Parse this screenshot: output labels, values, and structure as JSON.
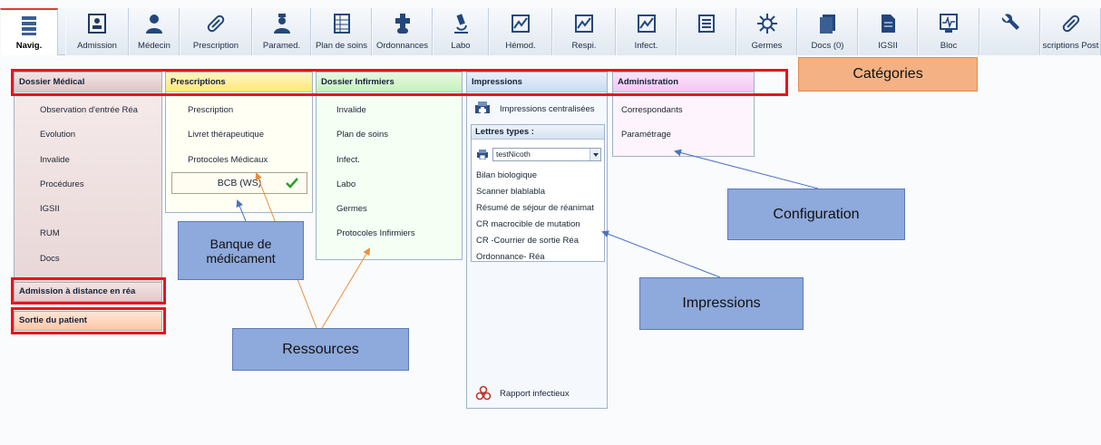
{
  "toolbar": {
    "tabs": [
      {
        "label": "Navig.",
        "icon": "grid-icon"
      },
      {
        "label": "Admission",
        "icon": "id-card-icon"
      },
      {
        "label": "Médecin",
        "icon": "doctor-icon"
      },
      {
        "label": "Prescription",
        "icon": "capsule-icon"
      },
      {
        "label": "Paramed.",
        "icon": "nurse-icon"
      },
      {
        "label": "Plan de soins",
        "icon": "care-plan-icon"
      },
      {
        "label": "Ordonnances",
        "icon": "cross-pill-icon"
      },
      {
        "label": "Labo",
        "icon": "microscope-icon"
      },
      {
        "label": "Hémod.",
        "icon": "chart-icon"
      },
      {
        "label": "Respi.",
        "icon": "chart-icon"
      },
      {
        "label": "Infect.",
        "icon": "chart-icon"
      },
      {
        "label": "",
        "icon": "list-icon"
      },
      {
        "label": "Germes",
        "icon": "germ-icon"
      },
      {
        "label": "Docs (0)",
        "icon": "documents-icon"
      },
      {
        "label": "IGSII",
        "icon": "file-icon"
      },
      {
        "label": "Bloc",
        "icon": "monitor-icon"
      },
      {
        "label": "",
        "icon": "wrench-icon"
      },
      {
        "label": "scriptions Post",
        "icon": "capsule-icon"
      }
    ]
  },
  "categories": {
    "dossier_medical": {
      "title": "Dossier Médical",
      "items": [
        "Observation d'entrée Réa",
        "Evolution",
        "Invalide",
        "Procédures",
        "IGSII",
        "RUM",
        "Docs"
      ]
    },
    "prescriptions": {
      "title": "Prescriptions",
      "items": [
        "Prescription",
        "Livret thérapeutique",
        "Protocoles Médicaux"
      ],
      "bcb": "BCB (WS)"
    },
    "dossier_infirmiers": {
      "title": "Dossier Infirmiers",
      "items": [
        "Invalide",
        "Plan de soins",
        "Infect.",
        "Labo",
        "Germes",
        "Protocoles Infirmiers"
      ]
    },
    "impressions": {
      "title": "Impressions",
      "centralized": "Impressions centralisées",
      "letters_title": "Lettres types :",
      "selected_template": "testNicoth",
      "letters": [
        "Bilan biologique",
        "Scanner blablabla",
        "Résumé de séjour de réanimat",
        "CR macrocible de mutation",
        "CR -Courrier de sortie Réa",
        "Ordonnance- Réa"
      ],
      "report": "Rapport infectieux"
    },
    "administration": {
      "title": "Administration",
      "items": [
        "Correspondants",
        "Paramétrage"
      ]
    }
  },
  "side_buttons": {
    "admission": "Admission à distance en réa",
    "sortie": "Sortie du patient"
  },
  "annotations": {
    "categories": "Catégories",
    "configuration": "Configuration",
    "banque_line1": "Banque de",
    "banque_line2": "médicament",
    "impressions": "Impressions",
    "ressources": "Ressources"
  },
  "colors": {
    "highlight": "#e8141a",
    "note_blue": "#8ea9db",
    "note_orange": "#f4b183",
    "arrow_blue": "#4a72c4",
    "arrow_orange": "#ed8c3a"
  }
}
